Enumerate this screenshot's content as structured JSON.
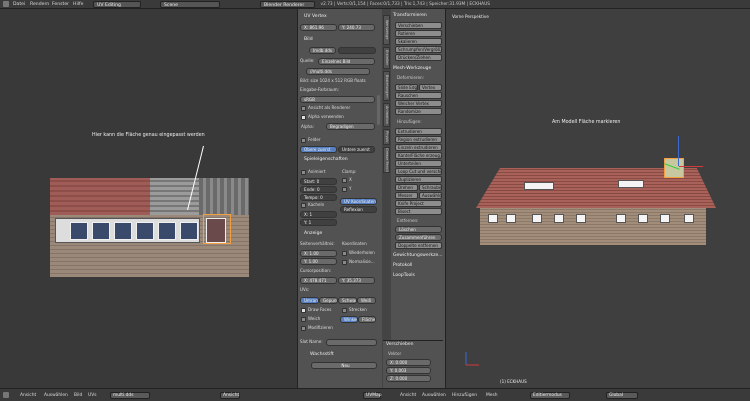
{
  "topbar": {
    "menus": [
      "Datei",
      "Rendern",
      "Fenster",
      "Hilfe"
    ],
    "layout": "UV Editing",
    "scene": "Scene",
    "renderer": "Blender Renderer",
    "stats": "v2.73 | Verts:0/1,154 | Faces:0/1,733 | Tris:1,743 | Speicher:31.93M | ECKHAUS"
  },
  "uv_editor": {
    "annotation": "Hier kann die Fläche genau eingepasst werden"
  },
  "view3d": {
    "title": "Vorne Perspektive",
    "annotation": "Am Modell Fläche markieren",
    "object_label": "(1) ECKHAUS"
  },
  "props": {
    "uv_vertex_header": "UV Vertex",
    "x_label": "X:",
    "x_value": "861.96",
    "y_label": "Y:",
    "y_value": "240.73",
    "bild_header": "Bild",
    "image_name": "Imdb.dds",
    "quelle_label": "Quelle:",
    "quelle_value": "Einzelnes Bild",
    "file_path": "//multi.dds",
    "image_info": "Bild: size 1024 x 512 RGB floats",
    "farbraum_label": "Eingabe-Farbraum:",
    "farbraum_value": "sRGB",
    "ansicht_label": "Ansicht als Renderer",
    "alpha_label": "Alpha verwenden",
    "alpha_mode_label": "Alpha:",
    "alpha_mode_value": "Begradigen",
    "felder_label": "Felder",
    "obere_zuerst": "Obere zuerst",
    "untere_zuerst": "Untere zuerst",
    "speicher_header": "Spieleigenschaften",
    "animiert_label": "Animiert",
    "clamp_label": "Clamp:",
    "start_label": "Start: 0",
    "ende_label": "Ende: 0",
    "tempo_label": "Tempo: 0",
    "clamp_x": "X",
    "clamp_y": "Y",
    "kacheln_label": "Kacheln",
    "uv_koordinaten": "UV Koordinaten",
    "reflexion": "Reflexion",
    "x_val_small": "X: 1",
    "y_val_small": "Y: 1",
    "anzeige_header": "Anzeige",
    "seitenverhaeltnis": "Seitenverhältnis:",
    "koordinaten": "Koordinaten",
    "asp_x": "X:",
    "asp_x_val": "1.00",
    "asp_y": "Y:",
    "asp_y_val": "1.00",
    "wiederholen": "Wiederholen",
    "normalisiert": "Normalisie...",
    "cursor_pos": "Cursorposition:",
    "cur_x": "X:",
    "cur_x_val": "478.471",
    "cur_y": "Y:",
    "cur_y_val": "35.373",
    "uvs_label": "UVs:",
    "uv_modes": [
      "Umrandu",
      "Gepunktet",
      "Schwarz",
      "Weiß"
    ],
    "draw_faces": "Draw Faces",
    "strecken": "Strecken",
    "weich": "Weich",
    "winkel": "Winkel",
    "flache": "Fläche",
    "modifizieren": "Modifizieren",
    "slot_name_label": "Slot Name:",
    "wachsstift": "Wachsstift",
    "neu": "Neu"
  },
  "vtabs": [
    "Werkzeuge",
    "Erstellen",
    "Beziehungen",
    "Animation",
    "Physik",
    "Grease Pencil"
  ],
  "tools": {
    "transform_header": "Transformieren",
    "transform_items": [
      "Verschieben",
      "Rotieren",
      "Skalieren",
      "Schrumpfen/Vergröß.",
      "Drücken/Ziehen"
    ],
    "mesh_header": "Mesh-Werkzeuge",
    "deform_label": "Deformieren:",
    "slide_edge": "Slide Edg",
    "vertex": "Vertex",
    "deform_items": [
      "Rauschen",
      "Weicher Vertex",
      "Randomize"
    ],
    "add_label": "Hinzufügen:",
    "add_items": [
      "Extrudieren",
      "Region extrudieren",
      "Einzeln extrudieren",
      "Kante/Fläche erzeug.",
      "Unterteilen",
      "Loop Cut und verschi.",
      "Duplizieren"
    ],
    "drehen": "Drehen",
    "schraube": "Schraube",
    "knife": "Messer",
    "select": "Auswähle",
    "knife_project": "Knife Project",
    "bisect": "Bisect",
    "remove_label": "Entfernen:",
    "loeschen": "Löschen",
    "zusammen": "Zusammenführen",
    "doppelte": "Doppelte entfernen",
    "glaetten": "Gewichtungswerkze...",
    "protokoll": "Protokoll",
    "looptools": "LoopTools"
  },
  "tpanel": {
    "header": "Verschieben",
    "vektor": "Vektor",
    "x": "X:",
    "x_val": "0.000",
    "y": "Y:",
    "y_val": "0.003",
    "z": "Z:",
    "z_val": "0.000"
  },
  "bottombar": {
    "left": [
      "Ansicht",
      "Auswählen",
      "Bild",
      "UVs"
    ],
    "image_name": "multi.dds",
    "view_mid": "Ansicht",
    "uvmap": "UVMap",
    "right": [
      "Ansicht",
      "Auswählen",
      "Hinzufügen",
      "Mesh"
    ],
    "mode": "Editiermodus",
    "pivot": "Global"
  }
}
